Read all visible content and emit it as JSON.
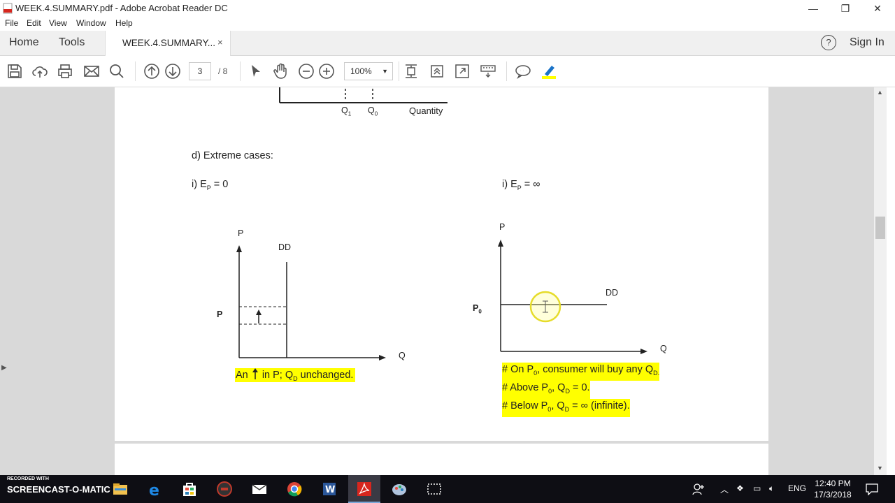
{
  "window": {
    "title": "WEEK.4.SUMMARY.pdf - Adobe Acrobat Reader DC",
    "minimize": "—",
    "restore": "❐",
    "close": "✕"
  },
  "menu": [
    "File",
    "Edit",
    "View",
    "Window",
    "Help"
  ],
  "tabs": {
    "home": "Home",
    "tools": "Tools",
    "document": "WEEK.4.SUMMARY...",
    "close": "×",
    "help": "?",
    "sign_in": "Sign In"
  },
  "toolbar": {
    "page_current": "3",
    "page_total": "/ 8",
    "zoom": "100%",
    "zoom_caret": "▼",
    "icons": [
      "save-icon",
      "upload-icon",
      "print-icon",
      "email-icon",
      "search-icon",
      "page-up-icon",
      "page-down-icon",
      "select-cursor-icon",
      "hand-icon",
      "zoom-out-icon",
      "zoom-in-icon",
      "fit-page-icon",
      "rotate-icon",
      "fullscreen-icon",
      "keyboard-icon",
      "comment-icon",
      "highlight-icon"
    ]
  },
  "document": {
    "top_graph": {
      "q1": "Q",
      "q1_sub": "1",
      "q0": "Q",
      "q0_sub": "0",
      "quantity": "Quantity"
    },
    "heading": "d) Extreme cases:",
    "case1": {
      "title_prefix": "i) E",
      "title_sub": "P",
      "title_suffix": " = 0",
      "axis_p": "P",
      "axis_q": "Q",
      "dd": "DD",
      "p_label": "P",
      "caption_a": "An",
      "caption_b": "in P; Q",
      "caption_sub": "D",
      "caption_c": " unchanged."
    },
    "case2": {
      "title_prefix": "i) E",
      "title_sub": "P",
      "title_suffix": " = ∞",
      "axis_p": "P",
      "axis_q": "Q",
      "dd": "DD",
      "p0": "P",
      "p0_sub": "0",
      "note1_a": "# On P",
      "note1_sub1": "0",
      "note1_b": ", consumer will buy any Q",
      "note1_sub2": "D.",
      "note2_a": "# Above P",
      "note2_sub1": "0",
      "note2_b": ", Q",
      "note2_sub2": "D",
      "note2_c": " = 0.",
      "note3_a": "# Below P",
      "note3_sub1": "0",
      "note3_b": ", Q",
      "note3_sub2": "D",
      "note3_c": " = ∞ (infinite)."
    }
  },
  "taskbar": {
    "recorder_small": "RECORDED WITH",
    "recorder_big": "SCREENCAST-O-MATIC",
    "lang": "ENG",
    "time": "12:40 PM",
    "date": "17/3/2018"
  },
  "colors": {
    "highlight": "#ffff00",
    "accent_blue": "#1a73c8",
    "acrobat_red": "#d7261e"
  }
}
